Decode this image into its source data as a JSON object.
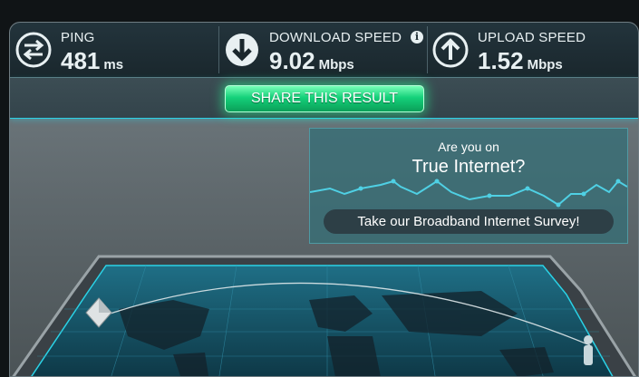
{
  "stats": {
    "ping": {
      "label": "PING",
      "value": "481",
      "unit": "ms",
      "icon": "ping-arrows-icon"
    },
    "download": {
      "label": "DOWNLOAD SPEED",
      "value": "9.02",
      "unit": "Mbps",
      "icon": "download-arrow-icon",
      "info_icon": "info-icon"
    },
    "upload": {
      "label": "UPLOAD SPEED",
      "value": "1.52",
      "unit": "Mbps",
      "icon": "upload-arrow-icon"
    }
  },
  "share": {
    "label": "SHARE THIS RESULT"
  },
  "survey": {
    "line1": "Are you on",
    "line2": "True Internet?",
    "button": "Take our Broadband Internet Survey!"
  },
  "colors": {
    "accent_green": "#14d17a",
    "accent_cyan": "#2ad2e6",
    "panel_dark": "#1a272d"
  }
}
